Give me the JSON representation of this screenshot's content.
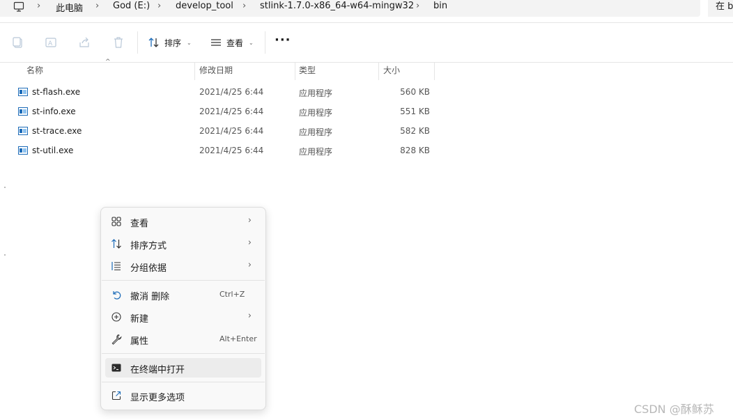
{
  "address": {
    "computer_icon": "computer-icon",
    "segments": [
      "此电脑",
      "God (E:)",
      "develop_tool",
      "stlink-1.7.0-x86_64-w64-mingw32",
      "bin"
    ],
    "search_placeholder": "在 b"
  },
  "toolbar": {
    "icons": [
      "copy-icon",
      "rename-icon",
      "share-icon",
      "delete-icon"
    ],
    "sort_label": "排序",
    "view_label": "查看",
    "more_label": "···"
  },
  "columns": {
    "name": "名称",
    "date": "修改日期",
    "type": "类型",
    "size": "大小"
  },
  "files": [
    {
      "name": "st-flash.exe",
      "date": "2021/4/25 6:44",
      "type": "应用程序",
      "size": "560 KB"
    },
    {
      "name": "st-info.exe",
      "date": "2021/4/25 6:44",
      "type": "应用程序",
      "size": "551 KB"
    },
    {
      "name": "st-trace.exe",
      "date": "2021/4/25 6:44",
      "type": "应用程序",
      "size": "582 KB"
    },
    {
      "name": "st-util.exe",
      "date": "2021/4/25 6:44",
      "type": "应用程序",
      "size": "828 KB"
    }
  ],
  "context_menu": {
    "items": [
      {
        "label": "查看",
        "icon": "grid-view-icon",
        "shortcut": "",
        "submenu": true
      },
      {
        "label": "排序方式",
        "icon": "sort-icon",
        "shortcut": "",
        "submenu": true
      },
      {
        "label": "分组依据",
        "icon": "group-icon",
        "shortcut": "",
        "submenu": true
      },
      {
        "label": "撤消 删除",
        "icon": "undo-icon",
        "shortcut": "Ctrl+Z",
        "submenu": false
      },
      {
        "label": "新建",
        "icon": "new-icon",
        "shortcut": "",
        "submenu": true
      },
      {
        "label": "属性",
        "icon": "wrench-icon",
        "shortcut": "Alt+Enter",
        "submenu": false
      },
      {
        "label": "在终端中打开",
        "icon": "terminal-icon",
        "shortcut": "",
        "submenu": false,
        "highlighted": true
      },
      {
        "label": "显示更多选项",
        "icon": "open-external-icon",
        "shortcut": "",
        "submenu": false
      }
    ]
  },
  "watermark": "CSDN @酥稣苏"
}
